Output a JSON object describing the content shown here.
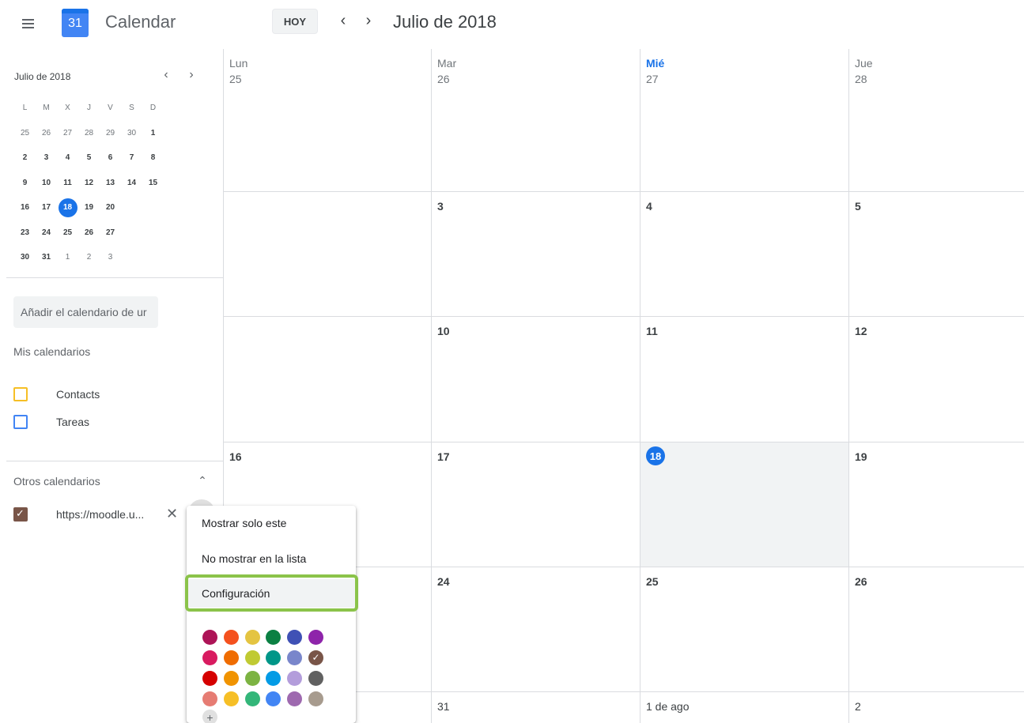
{
  "header": {
    "app_title": "Calendar",
    "logo_day": "31",
    "today_label": "HOY",
    "current_period": "Julio de 2018",
    "menu_icon": "hamburger-icon",
    "prev_icon": "chevron-left-icon",
    "next_icon": "chevron-right-icon"
  },
  "mini_calendar": {
    "title": "Julio de 2018",
    "weekday_headers": [
      "L",
      "M",
      "X",
      "J",
      "V",
      "S",
      "D"
    ],
    "weeks": [
      [
        "25",
        "26",
        "27",
        "28",
        "29",
        "30",
        "1"
      ],
      [
        "2",
        "3",
        "4",
        "5",
        "6",
        "7",
        "8"
      ],
      [
        "9",
        "10",
        "11",
        "12",
        "13",
        "14",
        "15"
      ],
      [
        "16",
        "17",
        "18",
        "19",
        "20",
        "",
        ""
      ],
      [
        "23",
        "24",
        "25",
        "26",
        "27",
        "",
        ""
      ],
      [
        "30",
        "31",
        "1",
        "2",
        "3",
        "",
        ""
      ]
    ],
    "today": "18",
    "accent_color": "#1a73e8"
  },
  "sidebar": {
    "add_calendar_placeholder": "Añadir el calendario de ur",
    "my_calendars_title": "Mis calendarios",
    "my_calendars": [
      {
        "label": "Contacts",
        "color": "#f6bf26",
        "checked": false
      },
      {
        "label": "Tareas",
        "color": "#4285f4",
        "checked": false
      }
    ],
    "other_calendars_title": "Otros calendarios",
    "other_calendars": [
      {
        "label": "https://moodle.u...",
        "color": "#795548",
        "checked": true
      }
    ]
  },
  "grid": {
    "weekday_headers": [
      "Lun",
      "Mar",
      "Mié",
      "Jue"
    ],
    "active_weekday": "Mié",
    "weeks": [
      [
        "25",
        "26",
        "27",
        "28"
      ],
      [
        "",
        "3",
        "4",
        "5"
      ],
      [
        "",
        "10",
        "11",
        "12"
      ],
      [
        "16",
        "17",
        "18",
        "19"
      ],
      [
        "",
        "",
        "24",
        "25",
        "26"
      ],
      [
        "",
        "31",
        "1 de ago",
        "2"
      ]
    ],
    "today": "18"
  },
  "context_menu": {
    "items": [
      "Mostrar solo este",
      "No mostrar en la lista",
      "Configuración"
    ],
    "highlighted": "Configuración",
    "highlight_color": "#8bc34a",
    "selected_color": "#795548",
    "colors": [
      [
        "#ad1457",
        "#f4511e",
        "#e4c441",
        "#0b8043",
        "#3f51b5",
        "#8e24aa"
      ],
      [
        "#d81b60",
        "#ef6c00",
        "#c0ca33",
        "#009688",
        "#7986cb",
        "#795548"
      ],
      [
        "#d50000",
        "#f09300",
        "#7cb342",
        "#039be5",
        "#b39ddb",
        "#616161"
      ],
      [
        "#e67c73",
        "#f6bf26",
        "#33b679",
        "#4285f4",
        "#9e69af",
        "#a79b8e"
      ]
    ],
    "add_color_label": "+"
  }
}
